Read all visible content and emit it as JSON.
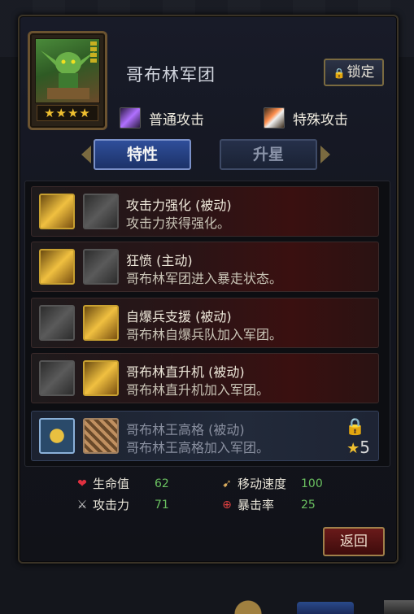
{
  "hero": {
    "name": "哥布林军团",
    "stars": "★★★★",
    "lock_label": "锁定"
  },
  "attacks": {
    "normal": "普通攻击",
    "special": "特殊攻击"
  },
  "tabs": [
    {
      "label": "特性",
      "active": true
    },
    {
      "label": "升星",
      "active": false
    }
  ],
  "skills": [
    {
      "name": "攻击力强化 (被动)",
      "desc": "攻击力获得强化。",
      "locked": false
    },
    {
      "name": "狂愤 (主动)",
      "desc": "哥布林军团进入暴走状态。",
      "locked": false
    },
    {
      "name": "自爆兵支援 (被动)",
      "desc": "哥布林自爆兵队加入军团。",
      "locked": false
    },
    {
      "name": "哥布林直升机 (被动)",
      "desc": "哥布林直升机加入军团。",
      "locked": false
    },
    {
      "name": "哥布林王高格 (被动)",
      "desc": "哥布林王高格加入军团。",
      "locked": true,
      "requirement": "5"
    }
  ],
  "stats": {
    "hp": {
      "label": "生命值",
      "value": "62"
    },
    "atk": {
      "label": "攻击力",
      "value": "71"
    },
    "speed": {
      "label": "移动速度",
      "value": "100"
    },
    "crit": {
      "label": "暴击率",
      "value": "25"
    }
  },
  "return_label": "返回",
  "colors": {
    "accent_gold": "#c8a030",
    "tab_blue": "#2f4e9a",
    "stat_green": "#6ac060",
    "return_red": "#6a1a1a"
  }
}
